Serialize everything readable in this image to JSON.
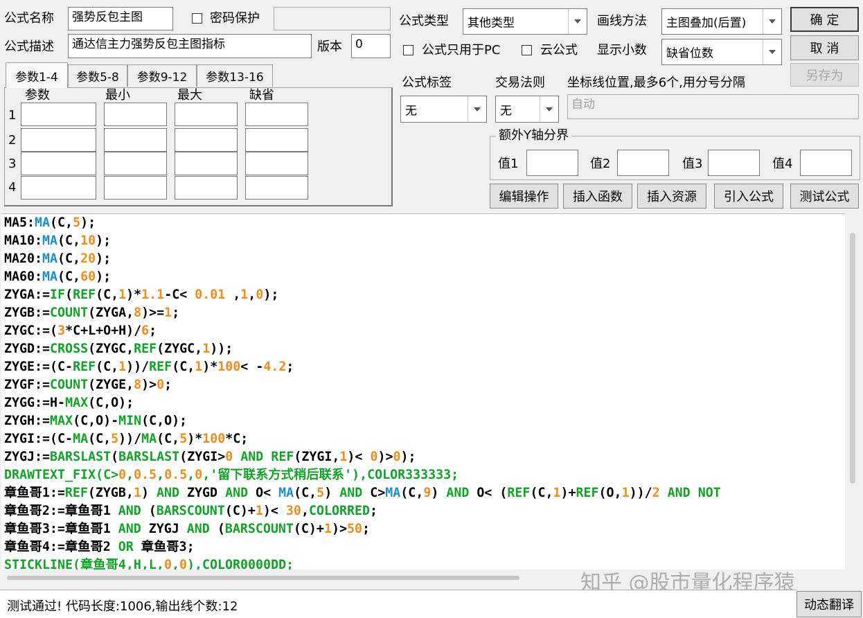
{
  "header": {
    "name_label": "公式名称",
    "name_value": "强势反包主图",
    "pwd_label": "密码保护",
    "desc_label": "公式描述",
    "desc_value": "通达信主力强势反包主图指标",
    "version_label": "版本",
    "version_value": "0",
    "type_label": "公式类型",
    "type_value": "其他类型",
    "draw_label": "画线方法",
    "draw_value": "主图叠加(后置)",
    "pc_label": "公式只用于PC",
    "cloud_label": "云公式",
    "decimals_label": "显示小数",
    "decimals_value": "缺省位数"
  },
  "buttons": {
    "ok": "确  定",
    "cancel": "取  消",
    "save_as": "另存为",
    "edit_ops": "编辑操作",
    "insert_func": "插入函数",
    "insert_res": "插入资源",
    "import_formula": "引入公式",
    "test_formula": "测试公式",
    "dynamic_translate": "动态翻译"
  },
  "tabs": [
    "参数1-4",
    "参数5-8",
    "参数9-12",
    "参数13-16"
  ],
  "params": {
    "headers": [
      "参数",
      "最小",
      "最大",
      "缺省"
    ],
    "rows": [
      "1",
      "2",
      "3",
      "4"
    ]
  },
  "tags": {
    "tag_label": "公式标签",
    "tag_value": "无",
    "rule_label": "交易法则",
    "rule_value": "无",
    "coord_label": "坐标线位置,最多6个,用分号分隔",
    "coord_value": "自动"
  },
  "yaxis": {
    "title": "额外Y轴分界",
    "v1": "值1",
    "v2": "值2",
    "v3": "值3",
    "v4": "值4"
  },
  "colors": {
    "default": "#000000",
    "func": "#1f8fc9",
    "num": "#f28c1c",
    "green": "#13a32a"
  },
  "code": [
    [
      [
        "MA5:",
        "d"
      ],
      [
        "MA",
        "f"
      ],
      [
        "(C,",
        "d"
      ],
      [
        "5",
        "n"
      ],
      [
        ");",
        "d"
      ]
    ],
    [
      [
        "MA10:",
        "d"
      ],
      [
        "MA",
        "f"
      ],
      [
        "(C,",
        "d"
      ],
      [
        "10",
        "n"
      ],
      [
        ");",
        "d"
      ]
    ],
    [
      [
        "MA20:",
        "d"
      ],
      [
        "MA",
        "f"
      ],
      [
        "(C,",
        "d"
      ],
      [
        "20",
        "n"
      ],
      [
        ");",
        "d"
      ]
    ],
    [
      [
        "MA60:",
        "d"
      ],
      [
        "MA",
        "f"
      ],
      [
        "(C,",
        "d"
      ],
      [
        "60",
        "n"
      ],
      [
        ");",
        "d"
      ]
    ],
    [
      [
        "ZYGA:=",
        "d"
      ],
      [
        "IF",
        "g"
      ],
      [
        "(",
        "d"
      ],
      [
        "REF",
        "g"
      ],
      [
        "(C,",
        "d"
      ],
      [
        "1",
        "n"
      ],
      [
        ")*",
        "d"
      ],
      [
        "1.1",
        "n"
      ],
      [
        "-C< ",
        "d"
      ],
      [
        "0.01",
        "n"
      ],
      [
        " ,",
        "d"
      ],
      [
        "1",
        "n"
      ],
      [
        ",",
        "d"
      ],
      [
        "0",
        "n"
      ],
      [
        ");",
        "d"
      ]
    ],
    [
      [
        "ZYGB:=",
        "d"
      ],
      [
        "COUNT",
        "g"
      ],
      [
        "(ZYGA,",
        "d"
      ],
      [
        "8",
        "n"
      ],
      [
        ")>=",
        "d"
      ],
      [
        "1",
        "n"
      ],
      [
        ";",
        "d"
      ]
    ],
    [
      [
        "ZYGC:=(",
        "d"
      ],
      [
        "3",
        "n"
      ],
      [
        "*C+L+O+H)/",
        "d"
      ],
      [
        "6",
        "n"
      ],
      [
        ";",
        "d"
      ]
    ],
    [
      [
        "ZYGD:=",
        "d"
      ],
      [
        "CROSS",
        "g"
      ],
      [
        "(ZYGC,",
        "d"
      ],
      [
        "REF",
        "g"
      ],
      [
        "(ZYGC,",
        "d"
      ],
      [
        "1",
        "n"
      ],
      [
        "));",
        "d"
      ]
    ],
    [
      [
        "ZYGE:=(C-",
        "d"
      ],
      [
        "REF",
        "g"
      ],
      [
        "(C,",
        "d"
      ],
      [
        "1",
        "n"
      ],
      [
        "))/",
        "d"
      ],
      [
        "REF",
        "g"
      ],
      [
        "(C,",
        "d"
      ],
      [
        "1",
        "n"
      ],
      [
        ")*",
        "d"
      ],
      [
        "100",
        "n"
      ],
      [
        "< -",
        "d"
      ],
      [
        "4.2",
        "n"
      ],
      [
        ";",
        "d"
      ]
    ],
    [
      [
        "ZYGF:=",
        "d"
      ],
      [
        "COUNT",
        "g"
      ],
      [
        "(ZYGE,",
        "d"
      ],
      [
        "8",
        "n"
      ],
      [
        ")>",
        "d"
      ],
      [
        "0",
        "n"
      ],
      [
        ";",
        "d"
      ]
    ],
    [
      [
        "ZYGG:=H-",
        "d"
      ],
      [
        "MAX",
        "g"
      ],
      [
        "(C,O);",
        "d"
      ]
    ],
    [
      [
        "ZYGH:=",
        "d"
      ],
      [
        "MAX",
        "g"
      ],
      [
        "(C,O)-",
        "d"
      ],
      [
        "MIN",
        "g"
      ],
      [
        "(C,O);",
        "d"
      ]
    ],
    [
      [
        "ZYGI:=(C-",
        "d"
      ],
      [
        "MA",
        "g"
      ],
      [
        "(C,",
        "d"
      ],
      [
        "5",
        "n"
      ],
      [
        "))/",
        "d"
      ],
      [
        "MA",
        "g"
      ],
      [
        "(C,",
        "d"
      ],
      [
        "5",
        "n"
      ],
      [
        ")*",
        "d"
      ],
      [
        "100",
        "n"
      ],
      [
        "*C;",
        "d"
      ]
    ],
    [
      [
        "ZYGJ:=",
        "d"
      ],
      [
        "BARSLAST",
        "g"
      ],
      [
        "(",
        "d"
      ],
      [
        "BARSLAST",
        "g"
      ],
      [
        "(ZYGI>",
        "d"
      ],
      [
        "0",
        "n"
      ],
      [
        " ",
        "d"
      ],
      [
        "AND",
        "g"
      ],
      [
        " ",
        "d"
      ],
      [
        "REF",
        "g"
      ],
      [
        "(ZYGI,",
        "d"
      ],
      [
        "1",
        "n"
      ],
      [
        ")< ",
        "d"
      ],
      [
        "0",
        "n"
      ],
      [
        ")>",
        "d"
      ],
      [
        "0",
        "n"
      ],
      [
        ");",
        "d"
      ]
    ],
    [
      [
        "DRAWTEXT_FIX",
        "g"
      ],
      [
        "(C>",
        "g"
      ],
      [
        "0",
        "n"
      ],
      [
        ",",
        "g"
      ],
      [
        "0.5",
        "n"
      ],
      [
        ",",
        "g"
      ],
      [
        "0.5",
        "n"
      ],
      [
        ",",
        "g"
      ],
      [
        "0",
        "n"
      ],
      [
        ",'留下联系方式稍后联系'),COLOR333333;",
        "g"
      ]
    ],
    [
      [
        "章鱼哥1:=",
        "d"
      ],
      [
        "REF",
        "g"
      ],
      [
        "(ZYGB,",
        "d"
      ],
      [
        "1",
        "n"
      ],
      [
        ") ",
        "d"
      ],
      [
        "AND",
        "g"
      ],
      [
        " ZYGD ",
        "d"
      ],
      [
        "AND",
        "g"
      ],
      [
        " O< ",
        "d"
      ],
      [
        "MA",
        "f"
      ],
      [
        "(C,",
        "d"
      ],
      [
        "5",
        "n"
      ],
      [
        ") ",
        "d"
      ],
      [
        "AND",
        "g"
      ],
      [
        " C>",
        "d"
      ],
      [
        "MA",
        "f"
      ],
      [
        "(C,",
        "d"
      ],
      [
        "9",
        "n"
      ],
      [
        ") ",
        "d"
      ],
      [
        "AND",
        "g"
      ],
      [
        " O< (",
        "d"
      ],
      [
        "REF",
        "g"
      ],
      [
        "(C,",
        "d"
      ],
      [
        "1",
        "n"
      ],
      [
        ")+",
        "d"
      ],
      [
        "REF",
        "g"
      ],
      [
        "(O,",
        "d"
      ],
      [
        "1",
        "n"
      ],
      [
        "))/",
        "d"
      ],
      [
        "2",
        "n"
      ],
      [
        " ",
        "d"
      ],
      [
        "AND",
        "g"
      ],
      [
        " ",
        "d"
      ],
      [
        "NOT",
        "g"
      ]
    ],
    [
      [
        "章鱼哥2:=章鱼哥1 ",
        "d"
      ],
      [
        "AND",
        "g"
      ],
      [
        " (",
        "d"
      ],
      [
        "BARSCOUNT",
        "g"
      ],
      [
        "(C)+",
        "d"
      ],
      [
        "1",
        "n"
      ],
      [
        ")< ",
        "d"
      ],
      [
        "30",
        "n"
      ],
      [
        ",",
        "d"
      ],
      [
        "COLORRED",
        "g"
      ],
      [
        ";",
        "d"
      ]
    ],
    [
      [
        "章鱼哥3:=章鱼哥1 ",
        "d"
      ],
      [
        "AND",
        "g"
      ],
      [
        " ZYGJ ",
        "d"
      ],
      [
        "AND",
        "g"
      ],
      [
        " (",
        "d"
      ],
      [
        "BARSCOUNT",
        "g"
      ],
      [
        "(C)+",
        "d"
      ],
      [
        "1",
        "n"
      ],
      [
        ")>",
        "d"
      ],
      [
        "50",
        "n"
      ],
      [
        ";",
        "d"
      ]
    ],
    [
      [
        "章鱼哥4:=章鱼哥2 ",
        "d"
      ],
      [
        "OR",
        "g"
      ],
      [
        " 章鱼哥3;",
        "d"
      ]
    ],
    [
      [
        "STICKLINE(章鱼哥4,H,L,",
        "g"
      ],
      [
        "0",
        "n"
      ],
      [
        ",",
        "g"
      ],
      [
        "0",
        "n"
      ],
      [
        "),COLOR0000DD;",
        "g"
      ]
    ]
  ],
  "status": "测试通过! 代码长度:1006,输出线个数:12",
  "watermark": "知乎 @股市量化程序猿"
}
